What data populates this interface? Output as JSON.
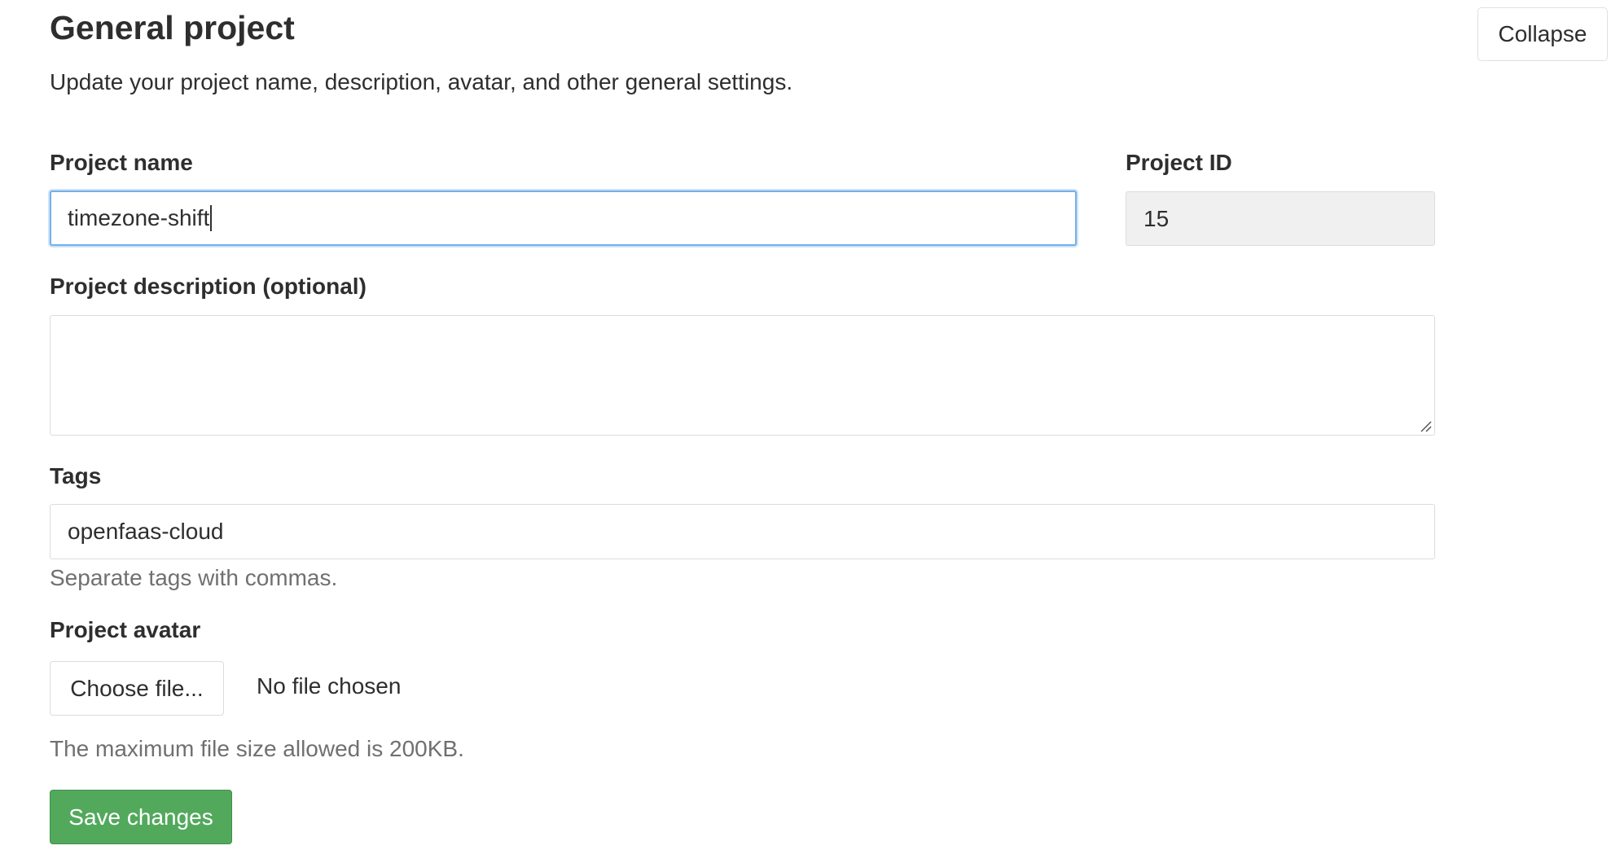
{
  "section": {
    "title": "General project",
    "description": "Update your project name, description, avatar, and other general settings.",
    "collapse_label": "Collapse"
  },
  "form": {
    "project_name": {
      "label": "Project name",
      "value": "timezone-shift"
    },
    "project_id": {
      "label": "Project ID",
      "value": "15"
    },
    "project_description": {
      "label": "Project description (optional)",
      "value": ""
    },
    "tags": {
      "label": "Tags",
      "value": "openfaas-cloud",
      "help": "Separate tags with commas."
    },
    "avatar": {
      "label": "Project avatar",
      "choose_label": "Choose file...",
      "status": "No file chosen",
      "help": "The maximum file size allowed is 200KB."
    },
    "save_label": "Save changes"
  },
  "colors": {
    "save_button": "#52a95c",
    "focus_border": "#73afea",
    "help_text": "#707070"
  }
}
